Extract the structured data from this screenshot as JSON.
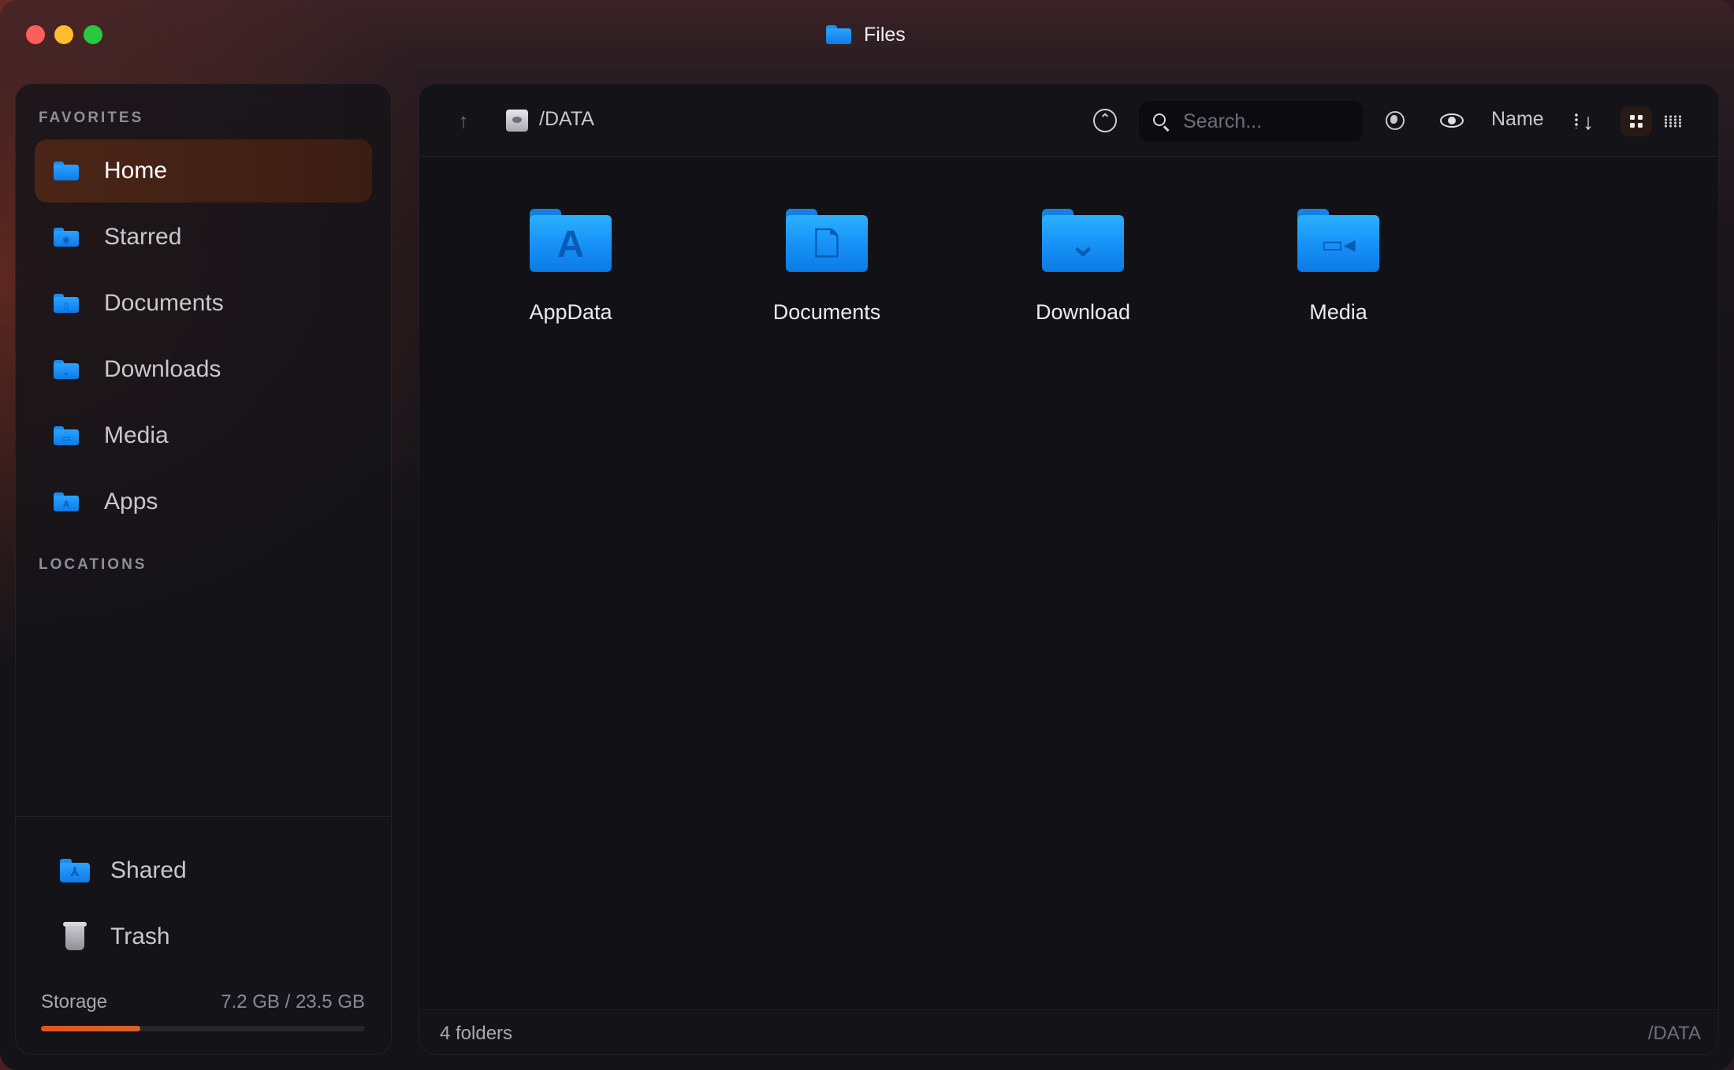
{
  "window": {
    "title": "Files"
  },
  "sidebar": {
    "favorites_label": "FAVORITES",
    "locations_label": "LOCATIONS",
    "items": [
      {
        "label": "Home",
        "icon": "folder-icon",
        "active": true
      },
      {
        "label": "Starred",
        "icon": "starred-folder-icon",
        "active": false
      },
      {
        "label": "Documents",
        "icon": "documents-folder-icon",
        "active": false
      },
      {
        "label": "Downloads",
        "icon": "downloads-folder-icon",
        "active": false
      },
      {
        "label": "Media",
        "icon": "media-folder-icon",
        "active": false
      },
      {
        "label": "Apps",
        "icon": "apps-folder-icon",
        "active": false
      }
    ],
    "bottom_items": [
      {
        "label": "Shared",
        "icon": "shared-folder-icon"
      },
      {
        "label": "Trash",
        "icon": "trash-icon"
      }
    ],
    "storage": {
      "label": "Storage",
      "value": "7.2 GB / 23.5 GB",
      "used_fraction": 0.306
    }
  },
  "toolbar": {
    "path": "/DATA",
    "search_placeholder": "Search...",
    "sort_label": "Name"
  },
  "content": {
    "folders": [
      {
        "name": "AppData",
        "icon": "appdata-folder-icon",
        "glyph": "A"
      },
      {
        "name": "Documents",
        "icon": "documents-folder-icon",
        "glyph": "🗋"
      },
      {
        "name": "Download",
        "icon": "download-folder-icon",
        "glyph": "⌄"
      },
      {
        "name": "Media",
        "icon": "media-folder-icon",
        "glyph": "▭◂"
      }
    ]
  },
  "footer": {
    "count": "4 folders",
    "path": "/DATA"
  },
  "colors": {
    "accent": "#e2531f",
    "folder_blue": "#1a8cf0",
    "active_item": "#4a2517"
  }
}
